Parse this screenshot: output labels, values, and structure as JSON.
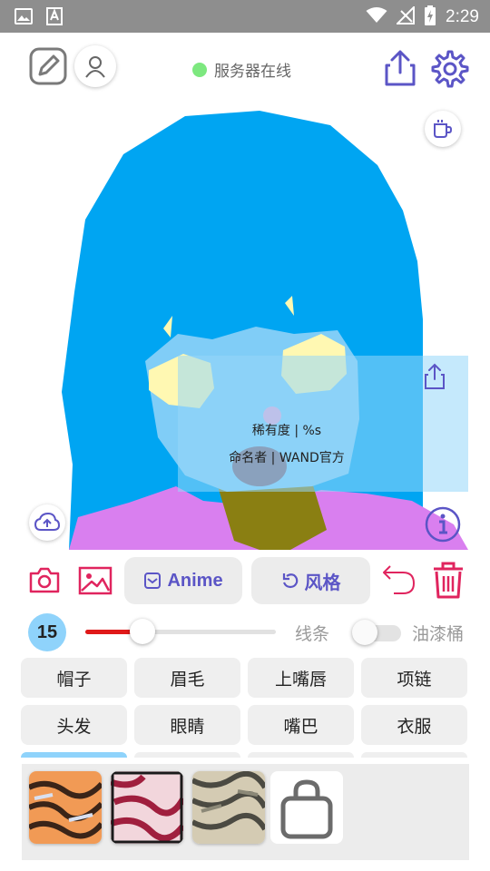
{
  "statusbar": {
    "time": "2:29"
  },
  "toolbar": {
    "server_status": "服务器在线"
  },
  "canvas": {
    "info_rarity": "稀有度 | %s",
    "info_author": "命名者 | WAND官方"
  },
  "tools": {
    "anime_label": "Anime",
    "style_label": "风格"
  },
  "brush": {
    "size": "15",
    "size_fraction": 0.3,
    "line_label": "线条",
    "bucket_label": "油漆桶",
    "bucket_on": false
  },
  "parts": {
    "row1": [
      "帽子",
      "眉毛",
      "上嘴唇",
      "项链"
    ],
    "row2": [
      "头发",
      "眼睛",
      "嘴巴",
      "衣服"
    ]
  },
  "colors": {
    "accent": "#5b55c6",
    "pink": "#e0245e",
    "online": "#7de87f",
    "brush": "#e01919",
    "hair": "#00a5f2"
  }
}
